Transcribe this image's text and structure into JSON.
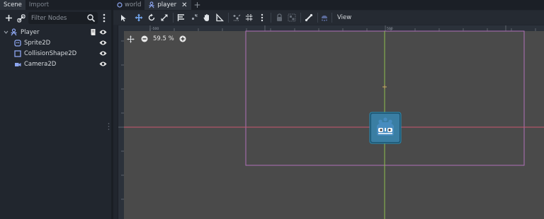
{
  "scene_dock": {
    "tabs": [
      {
        "label": "Scene",
        "active": true
      },
      {
        "label": "Import",
        "active": false
      }
    ],
    "filter": {
      "placeholder": "Filter Nodes",
      "value": ""
    },
    "tree": [
      {
        "label": "Player",
        "icon": "character-body-icon",
        "depth": 0,
        "expanded": true,
        "has_script": true,
        "visible": true
      },
      {
        "label": "Sprite2D",
        "icon": "sprite-icon",
        "depth": 1,
        "visible": true
      },
      {
        "label": "CollisionShape2D",
        "icon": "collision-shape-icon",
        "depth": 1,
        "visible": true
      },
      {
        "label": "Camera2D",
        "icon": "camera-icon",
        "depth": 1,
        "visible": true
      }
    ]
  },
  "editor_tabs": [
    {
      "label": "world",
      "icon": "scene-circle-icon",
      "active": false
    },
    {
      "label": "player",
      "icon": "character-body-icon",
      "active": true
    }
  ],
  "toolbar": {
    "view_label": "View"
  },
  "viewport": {
    "zoom_label": "59.5 %",
    "ruler_top_labels": [
      "|-500",
      "|500"
    ],
    "background_color": "#4a4a4a",
    "x_axis_color": "#c85870",
    "y_axis_color": "#8fbf4f",
    "camera_rect_color": "#b070b8",
    "sprite_icon": "godot-logo-icon"
  },
  "colors": {
    "accent": "#74a8f0",
    "panel": "#21262e"
  }
}
